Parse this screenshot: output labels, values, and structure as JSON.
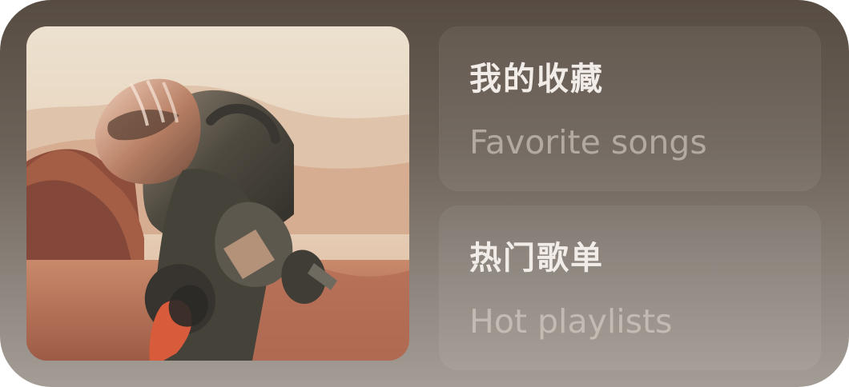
{
  "widget": {
    "artwork_alt": "astronaut on mars",
    "cards": [
      {
        "title": "我的收藏",
        "subtitle": "Favorite songs"
      },
      {
        "title": "热门歌单",
        "subtitle": "Hot playlists"
      }
    ]
  }
}
